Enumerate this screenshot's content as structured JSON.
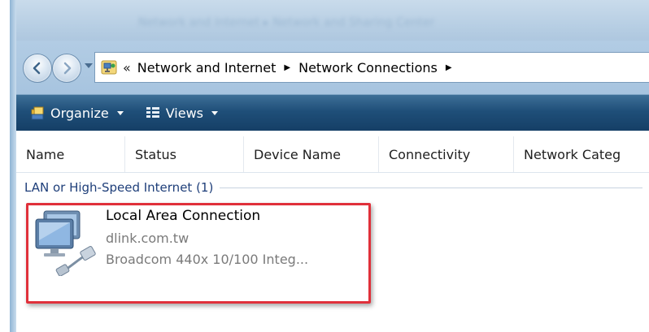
{
  "window": {
    "title": "Network and Internet ▸ Network and Sharing Center"
  },
  "address": {
    "chevron": "«",
    "crumbs": [
      "Network and Internet",
      "Network Connections"
    ],
    "separator": "▶"
  },
  "toolbar": {
    "organize_label": "Organize",
    "views_label": "Views"
  },
  "columns": [
    "Name",
    "Status",
    "Device Name",
    "Connectivity",
    "Network Categ"
  ],
  "group": {
    "label": "LAN or High-Speed Internet (1)"
  },
  "connection": {
    "name": "Local Area Connection",
    "domain": "dlink.com.tw",
    "device": "Broadcom 440x 10/100 Integ..."
  },
  "colors": {
    "toolbar": "#1f4f79",
    "highlight": "#e0303a",
    "group_text": "#1f3f7a"
  },
  "icons": {
    "back": "back-arrow-icon",
    "forward": "forward-arrow-icon",
    "network_folder": "network-connections-icon",
    "organize": "organize-icon",
    "views": "views-icon",
    "lan_adapter": "lan-adapter-icon"
  }
}
